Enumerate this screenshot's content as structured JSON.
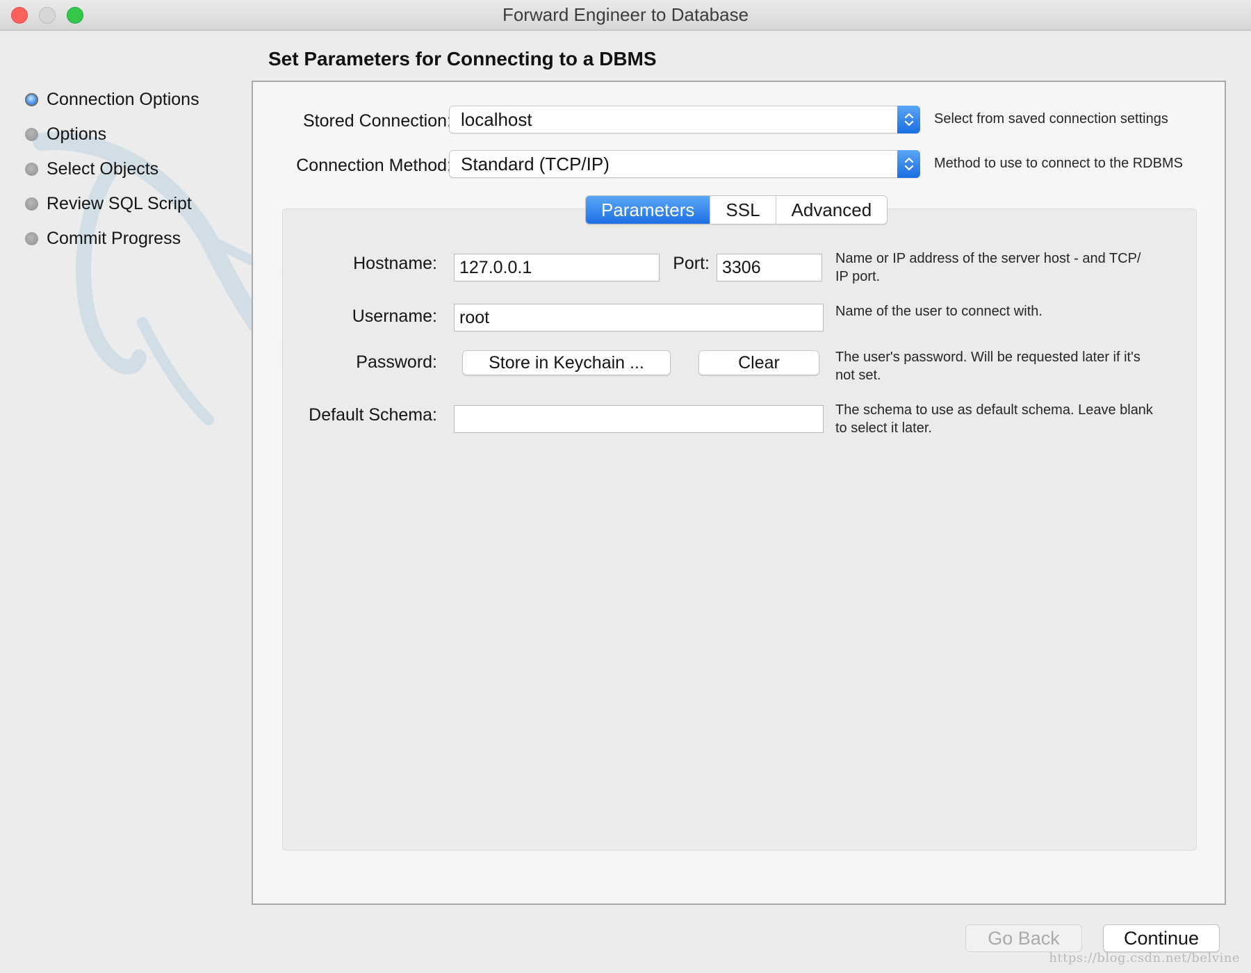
{
  "window": {
    "title": "Forward Engineer to Database"
  },
  "steps": [
    {
      "label": "Connection Options",
      "active": true
    },
    {
      "label": "Options",
      "active": false
    },
    {
      "label": "Select Objects",
      "active": false
    },
    {
      "label": "Review SQL Script",
      "active": false
    },
    {
      "label": "Commit Progress",
      "active": false
    }
  ],
  "page": {
    "title": "Set Parameters for Connecting to a DBMS"
  },
  "stored_connection": {
    "label": "Stored Connection:",
    "value": "localhost",
    "hint": "Select from saved connection settings"
  },
  "connection_method": {
    "label": "Connection Method:",
    "value": "Standard (TCP/IP)",
    "hint": "Method to use to connect to the RDBMS"
  },
  "tabs": [
    {
      "label": "Parameters",
      "selected": true
    },
    {
      "label": "SSL",
      "selected": false
    },
    {
      "label": "Advanced",
      "selected": false
    }
  ],
  "params": {
    "hostname": {
      "label": "Hostname:",
      "value": "127.0.0.1",
      "hint_line1": "Name or IP address of the server host - and TCP/",
      "hint_line2": "IP port."
    },
    "port": {
      "label": "Port:",
      "value": "3306"
    },
    "username": {
      "label": "Username:",
      "value": "root",
      "hint": "Name of the user to connect with."
    },
    "password": {
      "label": "Password:",
      "store_button": "Store in Keychain ...",
      "clear_button": "Clear",
      "hint_line1": "The user's password. Will be requested later if it's",
      "hint_line2": "not set."
    },
    "default_schema": {
      "label": "Default Schema:",
      "value": "",
      "hint_line1": "The schema to use as default schema. Leave blank",
      "hint_line2": "to select it later."
    }
  },
  "footer": {
    "back_label": "Go Back",
    "back_enabled": false,
    "continue_label": "Continue"
  },
  "source_watermark": "https://blog.csdn.net/belvine",
  "colors": {
    "accent": "#1e70e4",
    "window_bg": "#ececec",
    "close": "#fc605b",
    "zoom": "#34c748"
  }
}
